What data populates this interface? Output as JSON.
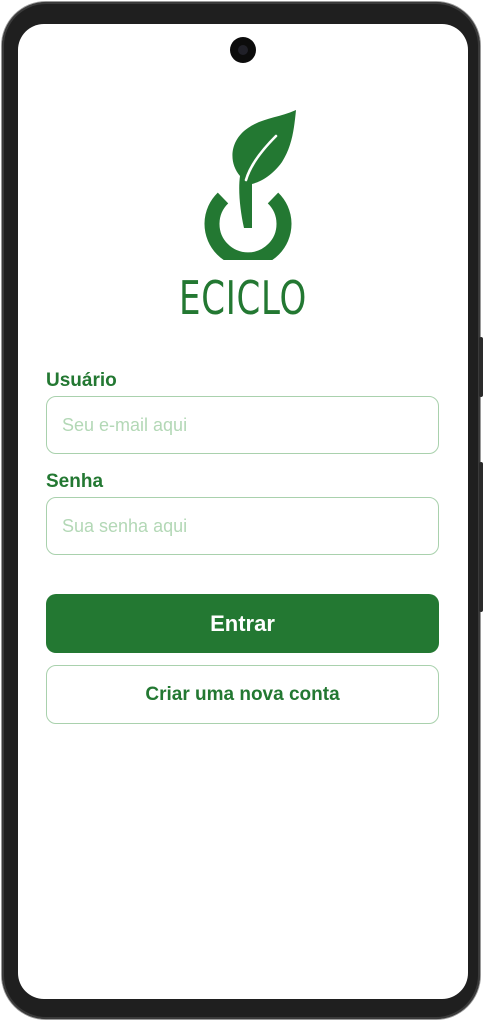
{
  "app": {
    "brand_name": "ECICLO",
    "logo_icon": "leaf-power-icon",
    "brand_color": "#237832",
    "border_color": "#a9d1ad",
    "placeholder_color": "#b3d8b6"
  },
  "login": {
    "username_label": "Usuário",
    "username_placeholder": "Seu e-mail aqui",
    "username_value": "",
    "password_label": "Senha",
    "password_placeholder": "Sua senha aqui",
    "password_value": "",
    "submit_label": "Entrar",
    "create_account_label": "Criar uma nova conta"
  }
}
